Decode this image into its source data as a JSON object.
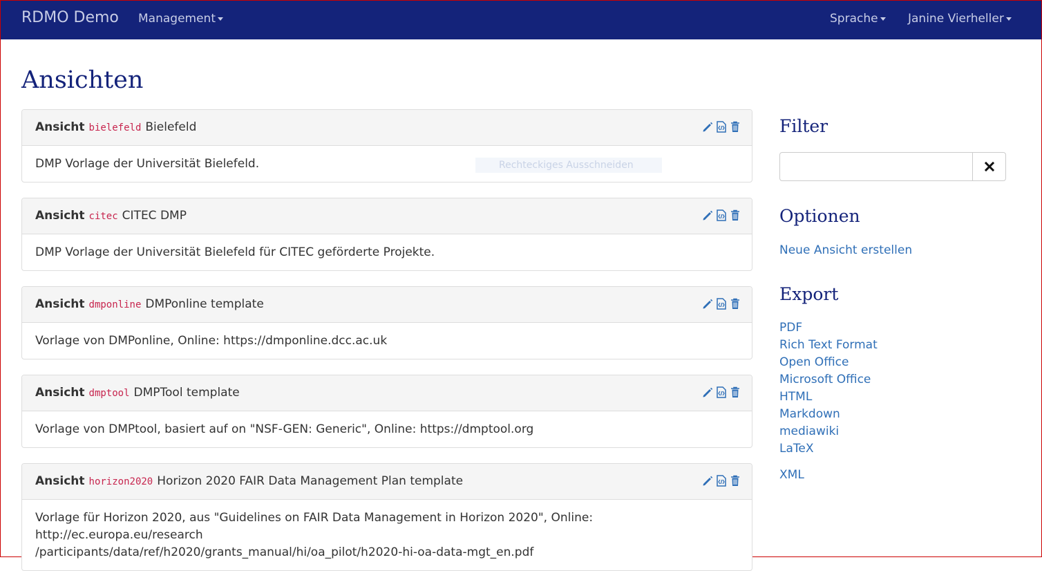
{
  "navbar": {
    "brand": "RDMO Demo",
    "management": "Management",
    "language": "Sprache",
    "user": "Janine Vierheller"
  },
  "page_title": "Ansichten",
  "panels": [
    {
      "label": "Ansicht",
      "key": "bielefeld",
      "title": "Bielefeld",
      "body": "DMP Vorlage der Universität Bielefeld."
    },
    {
      "label": "Ansicht",
      "key": "citec",
      "title": "CITEC DMP",
      "body": "DMP Vorlage der Universität Bielefeld für CITEC geförderte Projekte."
    },
    {
      "label": "Ansicht",
      "key": "dmponline",
      "title": "DMPonline template",
      "body": "Vorlage von DMPonline, Online: https://dmponline.dcc.ac.uk"
    },
    {
      "label": "Ansicht",
      "key": "dmptool",
      "title": "DMPTool template",
      "body": "Vorlage von DMPtool, basiert auf on \"NSF-GEN: Generic\", Online: https://dmptool.org"
    },
    {
      "label": "Ansicht",
      "key": "horizon2020",
      "title": "Horizon 2020 FAIR Data Management Plan template",
      "body_line1": "Vorlage für Horizon 2020, aus \"Guidelines on FAIR Data Management in Horizon 2020\", Online: http://ec.europa.eu/research",
      "body_line2": "/participants/data/ref/h2020/grants_manual/hi/oa_pilot/h2020-hi-oa-data-mgt_en.pdf"
    }
  ],
  "overlay_text": "Rechteckiges Ausschneiden",
  "sidebar": {
    "filter_heading": "Filter",
    "options_heading": "Optionen",
    "new_view": "Neue Ansicht erstellen",
    "export_heading": "Export",
    "exports": [
      "PDF",
      "Rich Text Format",
      "Open Office",
      "Microsoft Office",
      "HTML",
      "Markdown",
      "mediawiki",
      "LaTeX",
      "XML"
    ]
  },
  "icons": {
    "edit": "pencil-icon",
    "code": "code-file-icon",
    "delete": "trash-icon",
    "clear": "close-icon"
  },
  "colors": {
    "navbar": "#14237a",
    "heading": "#14237a",
    "link": "#2f6fb7",
    "key": "#c7254e"
  }
}
